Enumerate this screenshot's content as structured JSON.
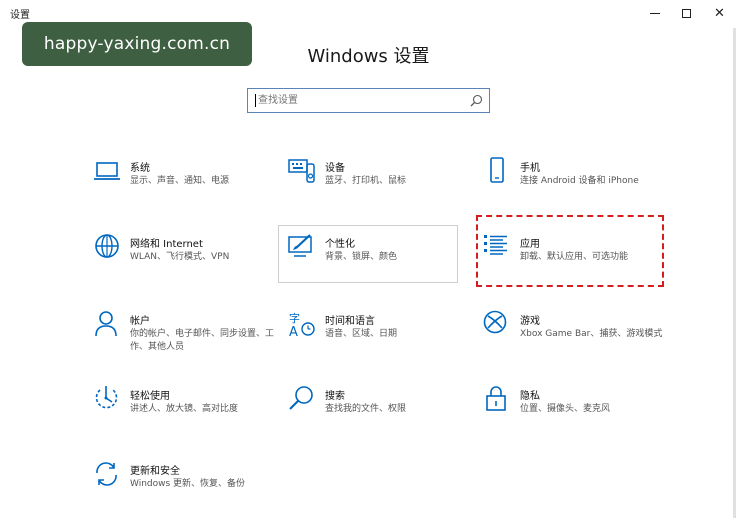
{
  "window": {
    "title": "设置",
    "minimize_icon": "minimize-icon",
    "maximize_icon": "maximize-icon",
    "close_symbol": "✕"
  },
  "watermark": {
    "text": "happy-yaxing.com.cn"
  },
  "header": {
    "title": "Windows 设置"
  },
  "search": {
    "placeholder": "查找设置",
    "icon": "search-icon"
  },
  "accent_color": "#0067c0",
  "highlight_color": "#d41d1d",
  "tiles": [
    {
      "title": "系统",
      "desc": "显示、声音、通知、电源",
      "icon": "laptop-icon"
    },
    {
      "title": "设备",
      "desc": "蓝牙、打印机、鼠标",
      "icon": "keyboard-icon"
    },
    {
      "title": "手机",
      "desc": "连接 Android 设备和 iPhone",
      "icon": "phone-icon"
    },
    {
      "title": "网络和 Internet",
      "desc": "WLAN、飞行模式、VPN",
      "icon": "globe-icon"
    },
    {
      "title": "个性化",
      "desc": "背景、锁屏、颜色",
      "icon": "paint-icon"
    },
    {
      "title": "应用",
      "desc": "卸载、默认应用、可选功能",
      "icon": "apps-list-icon"
    },
    {
      "title": "帐户",
      "desc": "你的帐户、电子邮件、同步设置、工作、其他人员",
      "icon": "person-icon"
    },
    {
      "title": "时间和语言",
      "desc": "语音、区域、日期",
      "icon": "time-language-icon"
    },
    {
      "title": "游戏",
      "desc": "Xbox Game Bar、捕获、游戏模式",
      "icon": "xbox-icon"
    },
    {
      "title": "轻松使用",
      "desc": "讲述人、放大镜、高对比度",
      "icon": "ease-of-access-icon"
    },
    {
      "title": "搜索",
      "desc": "查找我的文件、权限",
      "icon": "search-icon"
    },
    {
      "title": "隐私",
      "desc": "位置、摄像头、麦克风",
      "icon": "lock-icon"
    },
    {
      "title": "更新和安全",
      "desc": "Windows 更新、恢复、备份",
      "icon": "sync-icon"
    }
  ]
}
